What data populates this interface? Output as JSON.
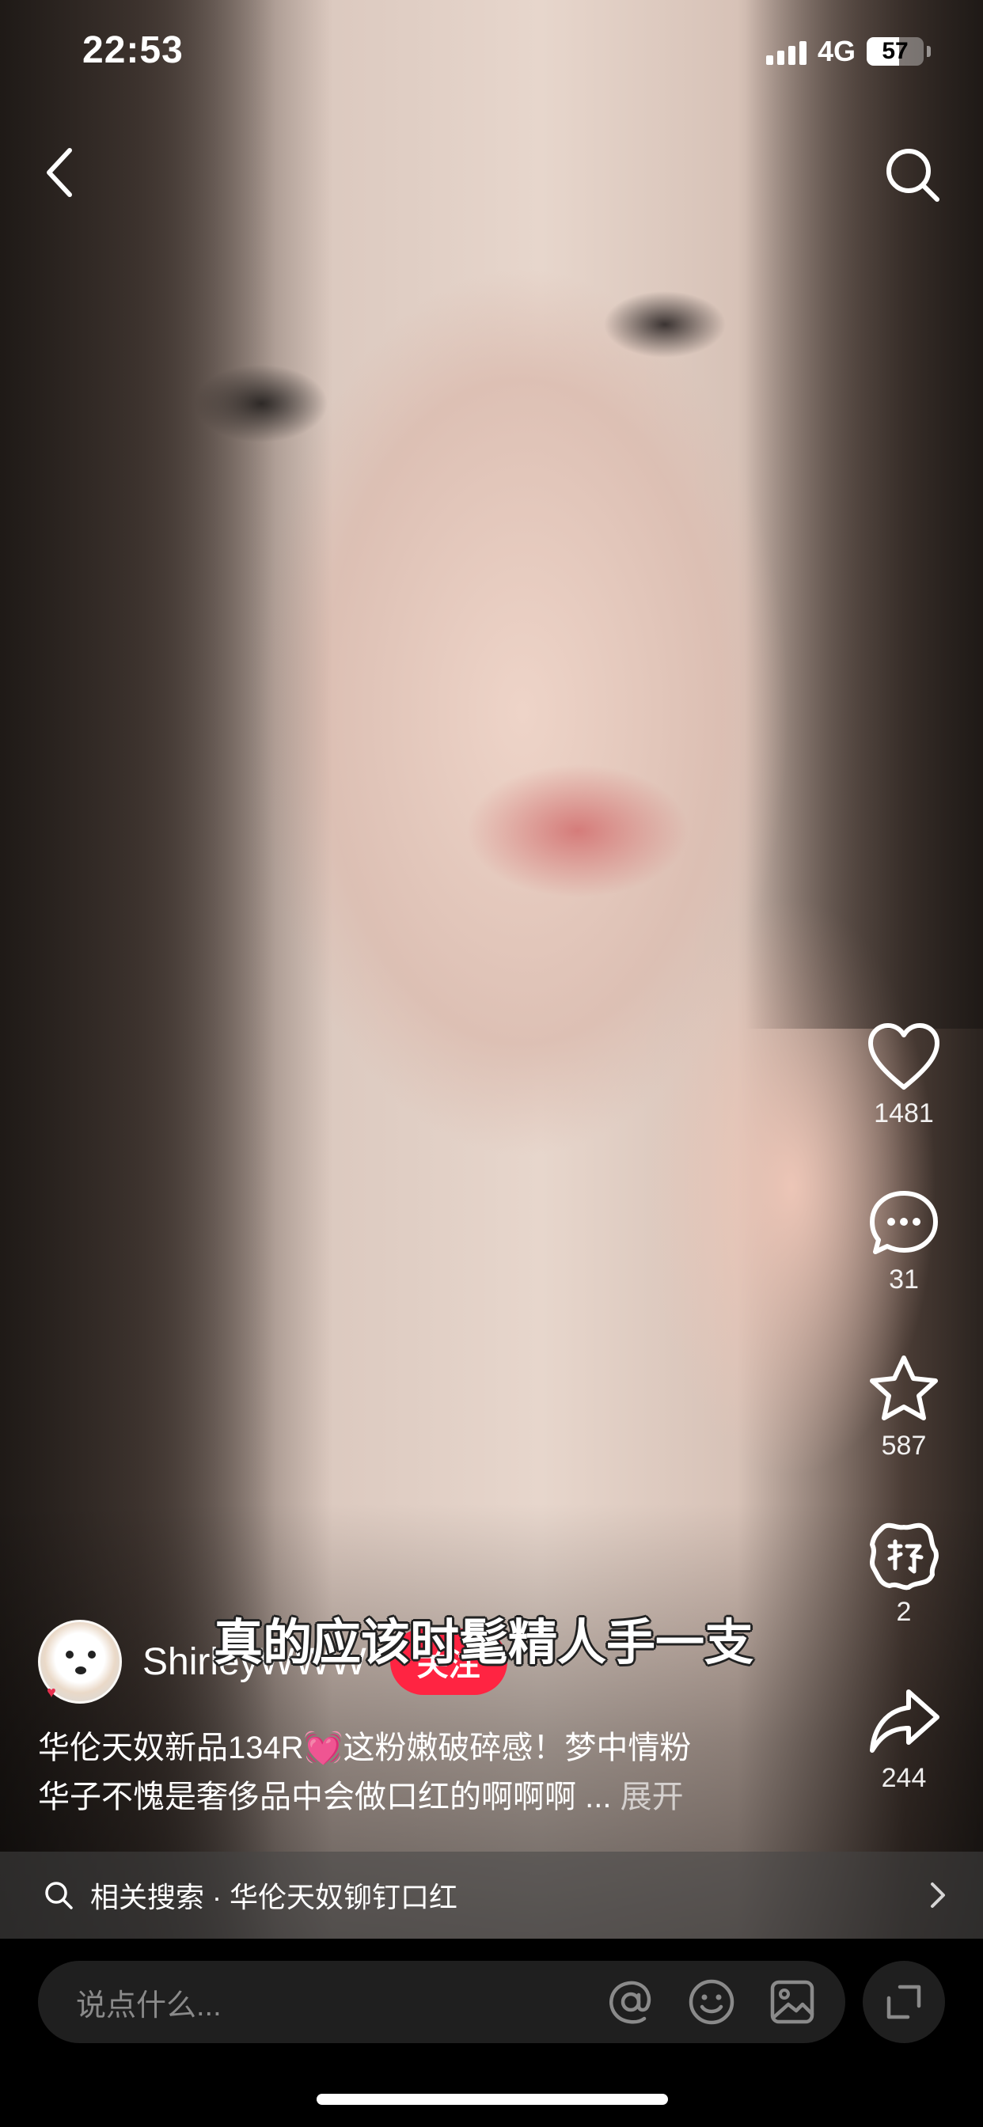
{
  "status_bar": {
    "time": "22:53",
    "network": "4G",
    "battery": "57",
    "battery_level": 0.57
  },
  "nav": {
    "back_icon": "chevron-left-icon",
    "search_icon": "search-icon"
  },
  "actions": {
    "like_count": "1481",
    "comment_count": "31",
    "collect_count": "587",
    "gift_count": "2",
    "share_count": "244"
  },
  "video": {
    "subtitle": "真的应该时髦精人手一支"
  },
  "author": {
    "name": "ShirleyWWW",
    "follow_label": "关注"
  },
  "caption": {
    "line1_prefix": "华伦天奴新品134R",
    "emoji": "💓",
    "line1_suffix": "这粉嫩破碎感！梦中情粉",
    "line2": "华子不愧是奢侈品中会做口红的啊啊啊 ... ",
    "expand_label": "展开"
  },
  "related_search": {
    "text": "相关搜索 · 华伦天奴铆钉口红"
  },
  "comment_bar": {
    "placeholder": "说点什么..."
  },
  "colors": {
    "follow": "#ff2442",
    "heart_emoji": "#ff3c8e"
  }
}
